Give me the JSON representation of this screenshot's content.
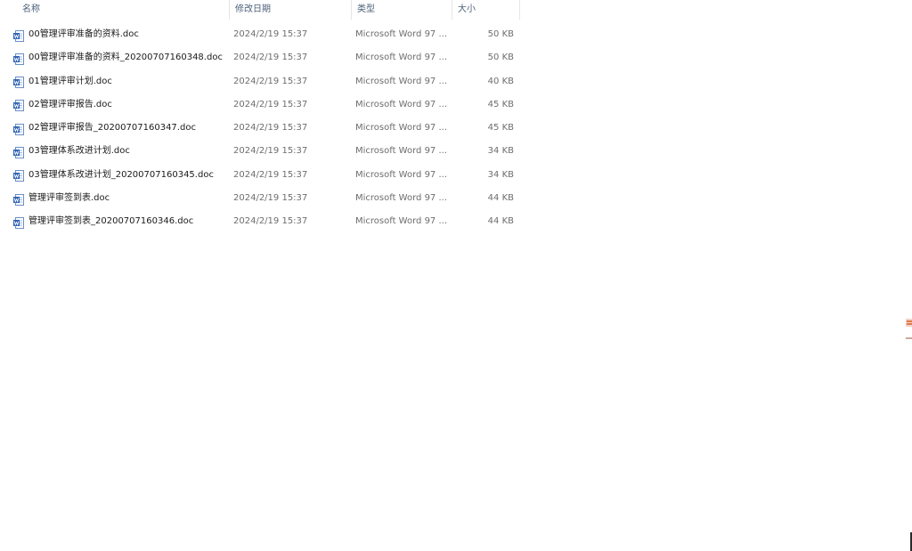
{
  "columns": {
    "name": "名称",
    "date": "修改日期",
    "type": "类型",
    "size": "大小"
  },
  "sort_indicator": "^",
  "icons": {
    "file": "word-doc-icon",
    "sort": "sort-ascending-icon"
  },
  "files": [
    {
      "name": "00管理评审准备的资料.doc",
      "date": "2024/2/19 15:37",
      "type": "Microsoft Word 97 ...",
      "size": "50 KB"
    },
    {
      "name": "00管理评审准备的资料_20200707160348.doc",
      "date": "2024/2/19 15:37",
      "type": "Microsoft Word 97 ...",
      "size": "50 KB"
    },
    {
      "name": "01管理评审计划.doc",
      "date": "2024/2/19 15:37",
      "type": "Microsoft Word 97 ...",
      "size": "40 KB"
    },
    {
      "name": "02管理评审报告.doc",
      "date": "2024/2/19 15:37",
      "type": "Microsoft Word 97 ...",
      "size": "45 KB"
    },
    {
      "name": "02管理评审报告_20200707160347.doc",
      "date": "2024/2/19 15:37",
      "type": "Microsoft Word 97 ...",
      "size": "45 KB"
    },
    {
      "name": "03管理体系改进计划.doc",
      "date": "2024/2/19 15:37",
      "type": "Microsoft Word 97 ...",
      "size": "34 KB"
    },
    {
      "name": "03管理体系改进计划_20200707160345.doc",
      "date": "2024/2/19 15:37",
      "type": "Microsoft Word 97 ...",
      "size": "34 KB"
    },
    {
      "name": "管理评审签到表.doc",
      "date": "2024/2/19 15:37",
      "type": "Microsoft Word 97 ...",
      "size": "44 KB"
    },
    {
      "name": "管理评审签到表_20200707160346.doc",
      "date": "2024/2/19 15:37",
      "type": "Microsoft Word 97 ...",
      "size": "44 KB"
    }
  ]
}
